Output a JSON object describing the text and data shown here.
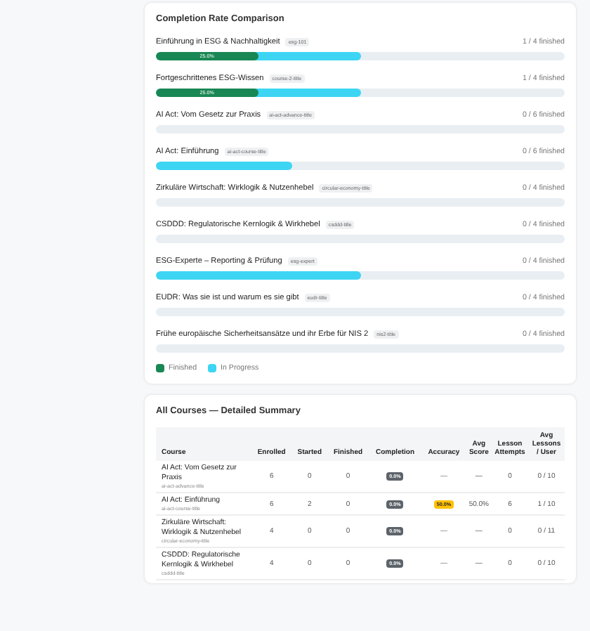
{
  "completion_card": {
    "title": "Completion Rate Comparison",
    "courses": [
      {
        "name": "Einführung in ESG & Nachhaltigkeit",
        "tag": "esg-101",
        "count": "1 / 4 finished",
        "segments": [
          {
            "kind": "in_progress",
            "level": 0.5
          },
          {
            "kind": "finished",
            "level": 0.25,
            "text": "25.0%"
          }
        ]
      },
      {
        "name": "Fortgeschrittenes ESG-Wissen",
        "tag": "course-2-title",
        "count": "1 / 4 finished",
        "segments": [
          {
            "kind": "in_progress",
            "level": 0.5
          },
          {
            "kind": "finished",
            "level": 0.25,
            "text": "25.0%"
          }
        ]
      },
      {
        "name": "AI Act: Vom Gesetz zur Praxis",
        "tag": "ai-act-advance-title",
        "count": "0 / 6 finished"
      },
      {
        "name": "AI Act: Einführung",
        "tag": "ai-act-course-title",
        "count": "0 / 6 finished",
        "segments": [
          {
            "kind": "in_progress",
            "level": 0.333
          }
        ]
      },
      {
        "name": "Zirkuläre Wirtschaft: Wirklogik & Nutzenhebel",
        "tag": "circular-economy-title",
        "count": "0 / 4 finished"
      },
      {
        "name": "CSDDD: Regulatorische Kernlogik & Wirkhebel",
        "tag": "csddd-title",
        "count": "0 / 4 finished"
      },
      {
        "name": "ESG-Experte – Reporting & Prüfung",
        "tag": "esg-expert",
        "count": "0 / 4 finished",
        "segments": [
          {
            "kind": "in_progress",
            "level": 0.5
          }
        ]
      },
      {
        "name": "EUDR: Was sie ist und warum es sie gibt",
        "tag": "eudr-title",
        "count": "0 / 4 finished"
      },
      {
        "name": "Frühe europäische Sicherheitsansätze und ihr Erbe für NIS 2",
        "tag": "nis2-title",
        "count": "0 / 4 finished"
      }
    ],
    "legend": [
      {
        "label": "Finished",
        "color": "#198754"
      },
      {
        "label": "In Progress",
        "color": "#3dd5f3"
      }
    ]
  },
  "summary_card": {
    "title": "All Courses — Detailed Summary",
    "columns": [
      "Course",
      "Enrolled",
      "Started",
      "Finished",
      "Completion",
      "Accuracy",
      "Avg Score",
      "Lesson Attempts",
      "Avg Lessons / User"
    ],
    "rows": [
      {
        "course": "AI Act: Vom Gesetz zur Praxis",
        "tag": "ai-act-advance-title",
        "enrolled": "6",
        "started": "0",
        "finished": "0",
        "completion": "0.0%",
        "accuracy": {
          "kind": "plain",
          "text": "—"
        },
        "avg_score": "—",
        "attempts": "0",
        "avg_lessons": "0 / 10"
      },
      {
        "course": "AI Act: Einführung",
        "tag": "ai-act-course-title",
        "enrolled": "6",
        "started": "2",
        "finished": "0",
        "completion": "0.0%",
        "accuracy": {
          "kind": "badge",
          "text": "50.0%"
        },
        "avg_score": "50.0%",
        "attempts": "6",
        "avg_lessons": "1 / 10"
      },
      {
        "course": "Zirkuläre Wirtschaft: Wirklogik & Nutzenhebel",
        "tag": "circular-economy-title",
        "enrolled": "4",
        "started": "0",
        "finished": "0",
        "completion": "0.0%",
        "accuracy": {
          "kind": "plain",
          "text": "—"
        },
        "avg_score": "—",
        "attempts": "0",
        "avg_lessons": "0 / 11"
      },
      {
        "course": "CSDDD: Regulatorische Kernlogik & Wirkhebel",
        "tag": "csddd-title",
        "enrolled": "4",
        "started": "0",
        "finished": "0",
        "completion": "0.0%",
        "accuracy": {
          "kind": "plain",
          "text": "—"
        },
        "avg_score": "—",
        "attempts": "0",
        "avg_lessons": "0 / 10"
      }
    ]
  }
}
